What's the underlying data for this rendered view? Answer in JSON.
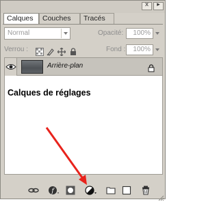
{
  "window": {
    "menu_icon": "panel-menu-icon",
    "close_icon": "close-x-icon",
    "close_glyph": "x",
    "menu_glyph": "▸"
  },
  "tabs": [
    {
      "label": "Calques",
      "active": true
    },
    {
      "label": "Couches",
      "active": false
    },
    {
      "label": "Tracés",
      "active": false
    }
  ],
  "tab_close_glyph": "x",
  "blend": {
    "mode": "Normal",
    "opacity_label": "Opacité:",
    "opacity_value": "100%"
  },
  "lock": {
    "label": "Verrou :",
    "icons": [
      "lock-transparency-icon",
      "lock-paint-icon",
      "lock-move-icon",
      "lock-all-icon"
    ],
    "fill_label": "Fond :",
    "fill_value": "100%"
  },
  "layers": [
    {
      "name": "Arrière-plan",
      "visible": true,
      "locked": true,
      "thumbnail_color": "#5a5f63"
    }
  ],
  "annotation": {
    "text": "Calques de réglages",
    "arrow_color": "#e8231c"
  },
  "bottom_icons": [
    "link-layers-icon",
    "layer-style-icon",
    "layer-mask-icon",
    "adjustment-layer-icon",
    "new-group-icon",
    "new-layer-icon",
    "trash-icon"
  ]
}
